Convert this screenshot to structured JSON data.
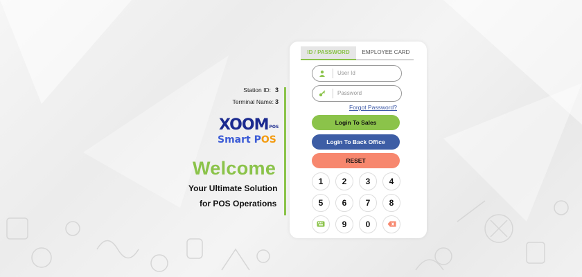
{
  "station": {
    "label": "Station ID:",
    "value": "3"
  },
  "terminal": {
    "label": "Terminal Name:",
    "value": "3"
  },
  "logo": {
    "brand": "XOOM",
    "brand_suffix": "POS",
    "product": "Smart P",
    "product_o": "O",
    "product_s": "S"
  },
  "welcome": "Welcome",
  "tagline": {
    "line1": "Your Ultimate Solution",
    "line2": "for POS Operations"
  },
  "tabs": {
    "id_password": "ID / PASSWORD",
    "employee_card": "EMPLOYEE CARD"
  },
  "fields": {
    "user_id": {
      "placeholder": "User Id",
      "value": ""
    },
    "password": {
      "placeholder": "Password",
      "value": ""
    }
  },
  "forgot_password": "Forgot Password?",
  "buttons": {
    "login_sales": "Login To Sales",
    "login_back_office": "Login To Back Office",
    "reset": "RESET"
  },
  "keypad": {
    "k1": "1",
    "k2": "2",
    "k3": "3",
    "k4": "4",
    "k5": "5",
    "k6": "6",
    "k7": "7",
    "k8": "8",
    "k9": "9",
    "k0": "0"
  },
  "colors": {
    "accent_green": "#8bc34a",
    "back_office_blue": "#3d5da5",
    "reset_salmon": "#f7876e",
    "brand_navy": "#1b2a8f",
    "brand_orange": "#f39c12"
  },
  "icons": {
    "user_field": "user-icon",
    "password_field": "key-icon",
    "keypad_enter": "keyboard-icon",
    "keypad_backspace": "backspace-icon"
  }
}
